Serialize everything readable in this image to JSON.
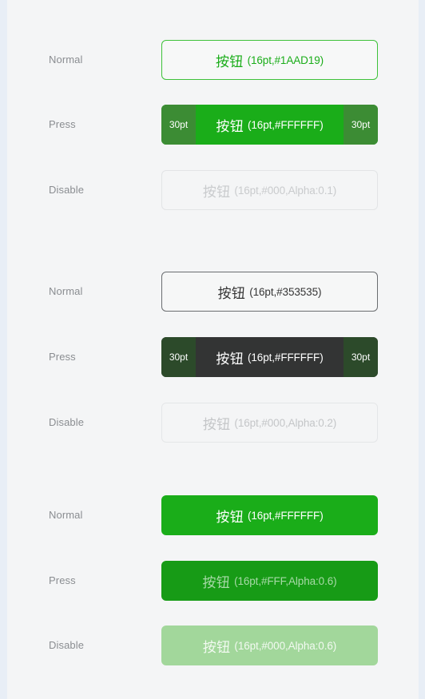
{
  "page": {
    "background_color": "#f4f5f6",
    "outer_border_color": "#e8eef6"
  },
  "groups": [
    {
      "id": "outline-green",
      "rows": [
        {
          "state_label": "Normal",
          "button": {
            "cn_label": "按钮",
            "meta_label": "(16pt,#1AAD19)",
            "style": "outline-green",
            "text_color": "#1AAD19",
            "bg_color": "#F7F8F8",
            "border_color": "#3EC23A",
            "pads": null
          }
        },
        {
          "state_label": "Press",
          "button": {
            "cn_label": "按钮",
            "meta_label": "(16pt,#FFFFFF)",
            "style": "press-green",
            "text_color": "#FFFFFF",
            "bg_color": "#1AAD19",
            "border_color": "",
            "pads": {
              "left": "30pt",
              "right": "30pt",
              "pad_color": "#3C8C34"
            }
          }
        },
        {
          "state_label": "Disable",
          "button": {
            "cn_label": "按钮",
            "meta_label": "(16pt,#000,Alpha:0.1)",
            "style": "outline-disable",
            "text_color": "#C9CBCD",
            "bg_color": "#F4F5F6",
            "border_color": "#E2E4E6",
            "pads": null
          }
        }
      ]
    },
    {
      "id": "outline-dark",
      "rows": [
        {
          "state_label": "Normal",
          "button": {
            "cn_label": "按钮",
            "meta_label": "(16pt,#353535)",
            "style": "outline-dark",
            "text_color": "#353535",
            "bg_color": "#F6F7F7",
            "border_color": "#6A6D70",
            "pads": null
          }
        },
        {
          "state_label": "Press",
          "button": {
            "cn_label": "按钮",
            "meta_label": "(16pt,#FFFFFF)",
            "style": "press-dark",
            "text_color": "#FFFFFF",
            "bg_color": "#333434",
            "border_color": "",
            "pads": {
              "left": "30pt",
              "right": "30pt",
              "pad_color": "#2C4A2A"
            }
          }
        },
        {
          "state_label": "Disable",
          "button": {
            "cn_label": "按钮",
            "meta_label": "(16pt,#000,Alpha:0.2)",
            "style": "outline-disable2",
            "text_color": "#C4C6C8",
            "bg_color": "#F4F5F6",
            "border_color": "#E4E6E8",
            "pads": null
          }
        }
      ]
    },
    {
      "id": "solid-green",
      "rows": [
        {
          "state_label": "Normal",
          "button": {
            "cn_label": "按钮",
            "meta_label": "(16pt,#FFFFFF)",
            "style": "solid-green",
            "text_color": "#FFFFFF",
            "bg_color": "#1AAD19",
            "border_color": "",
            "pads": null
          }
        },
        {
          "state_label": "Press",
          "button": {
            "cn_label": "按钮",
            "meta_label": "(16pt,#FFF,Alpha:0.6)",
            "style": "solid-green-press",
            "text_color": "rgba(255,255,255,0.6)",
            "bg_color": "#179B16",
            "border_color": "",
            "pads": null
          }
        },
        {
          "state_label": "Disable",
          "button": {
            "cn_label": "按钮",
            "meta_label": "(16pt,#000,Alpha:0.6)",
            "style": "solid-green-disable",
            "text_color": "#FFFFFF",
            "bg_color": "#A2D79B",
            "border_color": "",
            "pads": null
          }
        }
      ]
    }
  ]
}
